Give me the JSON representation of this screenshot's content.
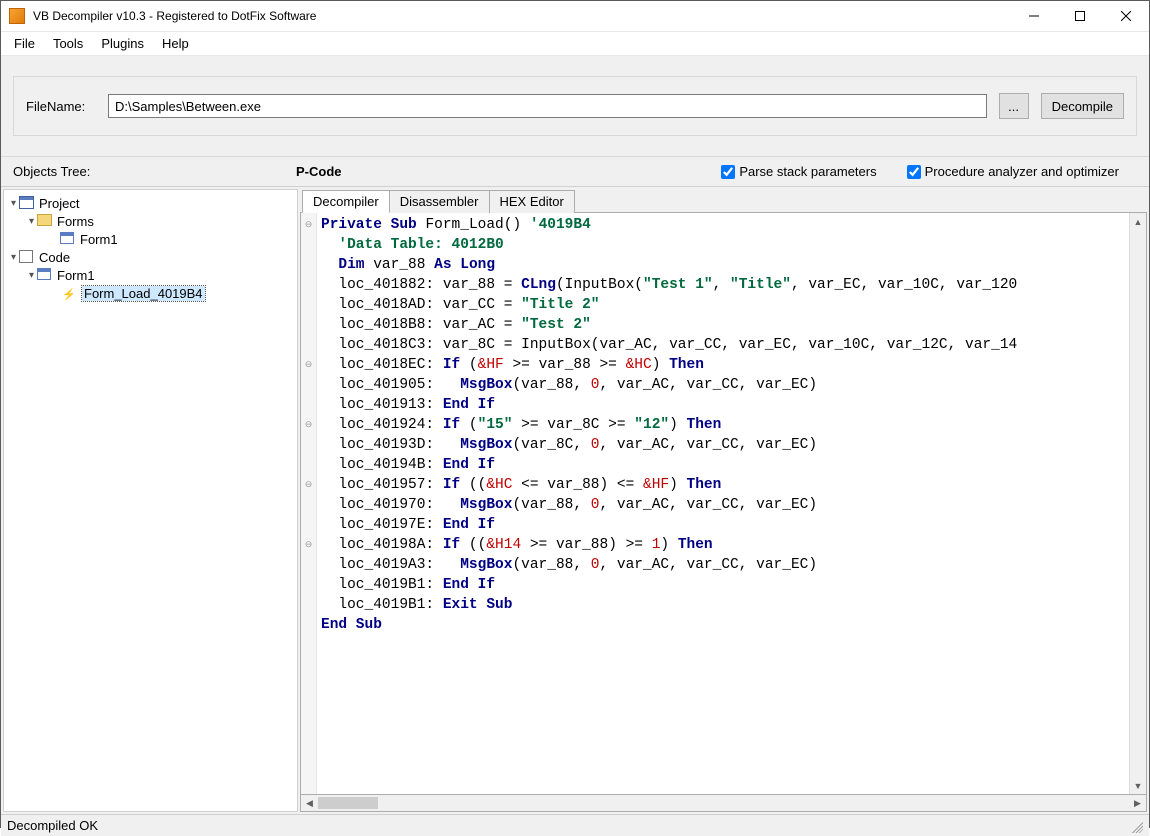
{
  "window": {
    "title": "VB Decompiler v10.3 - Registered to DotFix Software"
  },
  "menu": {
    "file": "File",
    "tools": "Tools",
    "plugins": "Plugins",
    "help": "Help"
  },
  "file_panel": {
    "label": "FileName:",
    "path": "D:\\Samples\\Between.exe",
    "browse": "...",
    "decompile": "Decompile"
  },
  "headers": {
    "tree": "Objects Tree:",
    "pcode": "P-Code",
    "chk_parse": "Parse stack parameters",
    "chk_opt": "Procedure analyzer and optimizer"
  },
  "tree": {
    "project": "Project",
    "forms": "Forms",
    "form1a": "Form1",
    "code": "Code",
    "form1b": "Form1",
    "method": "Form_Load_4019B4"
  },
  "tabs": {
    "decompiler": "Decompiler",
    "disassembler": "Disassembler",
    "hex": "HEX Editor"
  },
  "code_tokens": {
    "private": "Private",
    "sub": "Sub",
    "form_load": "Form_Load",
    "addr": "'4019B4",
    "comment": "'Data Table: 4012B0",
    "dim": "Dim",
    "as": "As",
    "long": "Long",
    "v88": "var_88",
    "l1882": "loc_401882:",
    "clng": "CLng",
    "inputbox": "InputBox",
    "t1": "\"Test 1\"",
    "title1": "\"Title\"",
    "vEC": "var_EC",
    "v10C": "var_10C",
    "trail1": "var_120",
    "l18AD": "loc_4018AD:",
    "vCC": "var_CC",
    "title2": "\"Title 2\"",
    "l18B8": "loc_4018B8:",
    "vAC": "var_AC",
    "test2": "\"Test 2\"",
    "l18C3": "loc_4018C3:",
    "v8C": "var_8C",
    "v12C": "var_12C",
    "trail2": "var_14",
    "l18EC": "loc_4018EC:",
    "if": "If",
    "then": "Then",
    "HF": "&HF",
    "HC": "&HC",
    "l1905": "loc_401905:",
    "msgbox": "MsgBox",
    "zero": "0",
    "l1913": "loc_401913:",
    "endif": "End If",
    "l1924": "loc_401924:",
    "s15": "\"15\"",
    "s12": "\"12\"",
    "l193D": "loc_40193D:",
    "l194B": "loc_40194B:",
    "l1957": "loc_401957:",
    "l1970": "loc_401970:",
    "l197E": "loc_40197E:",
    "l198A": "loc_40198A:",
    "H14": "&H14",
    "one": "1",
    "l19A3": "loc_4019A3:",
    "l19B1a": "loc_4019B1:",
    "l19B1b": "loc_4019B1:",
    "exit": "Exit Sub",
    "endsub": "End Sub"
  },
  "status": {
    "text": "Decompiled OK"
  }
}
